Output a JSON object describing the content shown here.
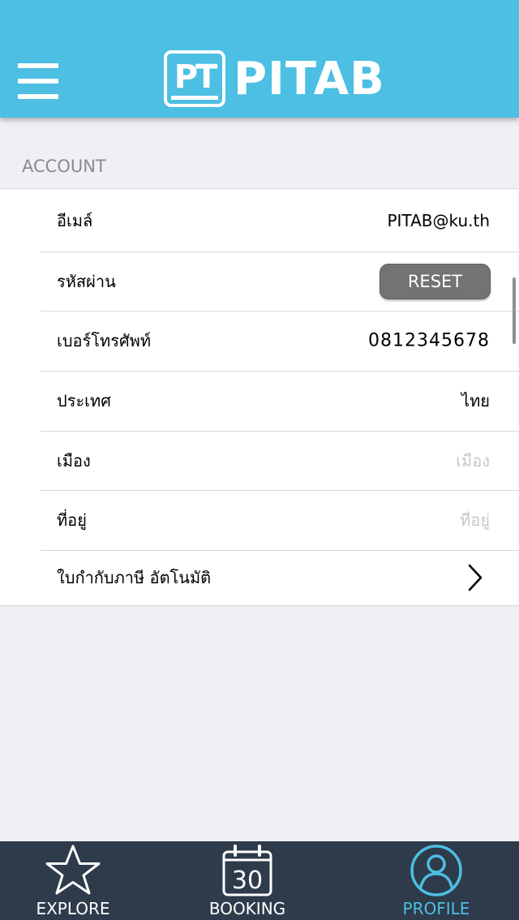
{
  "header": {
    "logo_mark": "PT",
    "logo_text": "PITAB"
  },
  "section": {
    "title": "ACCOUNT"
  },
  "rows": {
    "email": {
      "label": "อีเมล์",
      "value": "PITAB@ku.th"
    },
    "password": {
      "label": "รหัสผ่าน",
      "button": "RESET"
    },
    "phone": {
      "label": "เบอร์โทรศัพท์",
      "value": "0812345678"
    },
    "country": {
      "label": "ประเทศ",
      "value": "ไทย"
    },
    "city": {
      "label": "เมือง",
      "placeholder": "เมือง"
    },
    "address": {
      "label": "ที่อยู่",
      "placeholder": "ที่อยู่"
    },
    "tax_invoice": {
      "label": "ใบกำกับภาษี อัตโนมัติ"
    }
  },
  "tabs": {
    "explore": {
      "label": "EXPLORE",
      "icon": "star-icon"
    },
    "booking": {
      "label": "BOOKING",
      "icon": "calendar-icon",
      "day": "30"
    },
    "profile": {
      "label": "PROFILE",
      "icon": "user-icon",
      "active": true
    }
  },
  "colors": {
    "header": "#4cbfe3",
    "tabbar": "#2e3b4b",
    "active_tab": "#4cbfe3",
    "reset_button": "#737373",
    "background": "#efeff4"
  }
}
